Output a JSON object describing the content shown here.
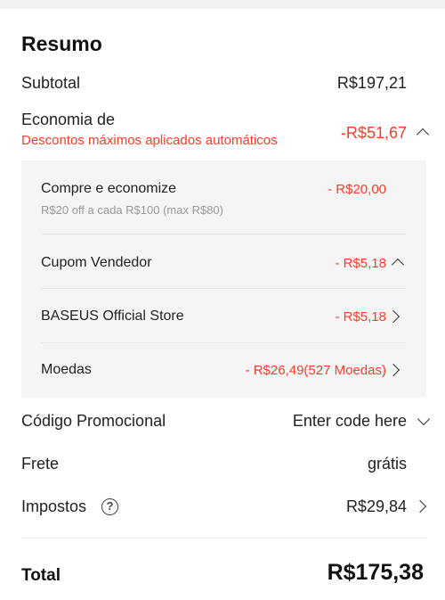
{
  "summary": {
    "title": "Resumo",
    "subtotal": {
      "label": "Subtotal",
      "value": "R$197,21"
    },
    "savings": {
      "label": "Economia de",
      "note": "Descontos máximos aplicados automáticos",
      "value": "-R$51,67"
    },
    "discounts": [
      {
        "label": "Compre e economize",
        "note": "R$20 off a cada R$100 (max R$80)",
        "value": "- R$20,00"
      },
      {
        "label": "Cupom Vendedor",
        "value": "- R$5,18"
      },
      {
        "label": "BASEUS Official Store",
        "value": "- R$5,18"
      },
      {
        "label": "Moedas",
        "value": "- R$26,49(527 Moedas)"
      }
    ],
    "promo": {
      "label": "Código Promocional",
      "placeholder": "Enter code here"
    },
    "shipping": {
      "label": "Frete",
      "value": "grátis"
    },
    "taxes": {
      "label": "Impostos",
      "value": "R$29,84",
      "help": "?"
    },
    "total": {
      "label": "Total",
      "value": "R$175,38"
    }
  },
  "colors": {
    "accent": "#fd3c26",
    "panel_bg": "#f5f5f5",
    "muted": "#999999"
  },
  "icons": [
    "chevron-up-icon",
    "chevron-right-icon",
    "chevron-down-icon",
    "help-icon"
  ]
}
